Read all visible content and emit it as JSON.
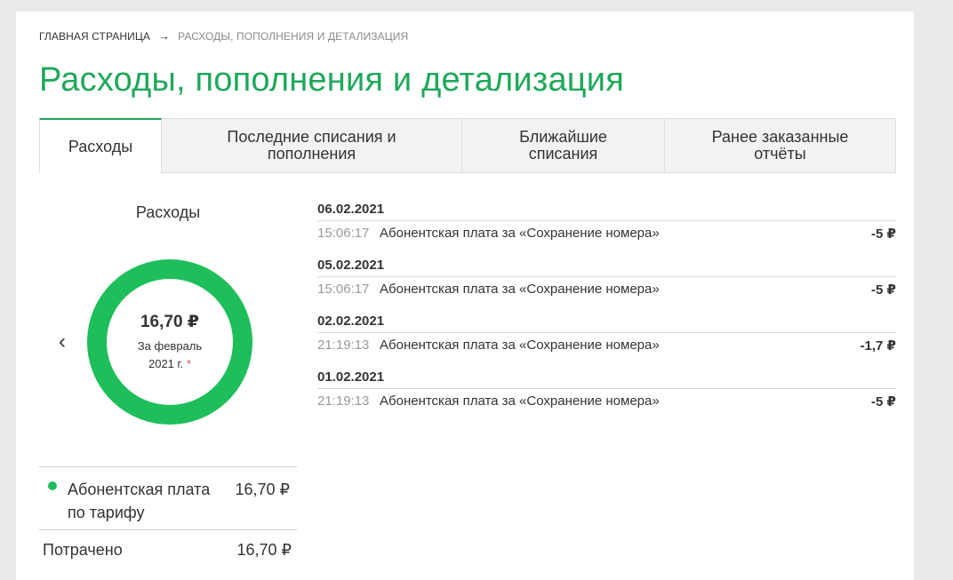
{
  "breadcrumb": {
    "home": "ГЛАВНАЯ СТРАНИЦА",
    "arrow": "→",
    "current": "РАСХОДЫ, ПОПОЛНЕНИЯ И ДЕТАЛИЗАЦИЯ"
  },
  "page_title": "Расходы, пополнения и детализация",
  "tabs": [
    {
      "line1": "Расходы",
      "line2": "",
      "active": true
    },
    {
      "line1": "Последние списания и",
      "line2": "пополнения",
      "active": false
    },
    {
      "line1": "Ближайшие",
      "line2": "списания",
      "active": false
    },
    {
      "line1": "Ранее заказанные",
      "line2": "отчёты",
      "active": false
    }
  ],
  "expenses": {
    "title": "Расходы",
    "prev_icon": "chevron-left-icon",
    "prev_glyph": "‹",
    "amount": "16,70 ₽",
    "period_line1": "За февраль",
    "period_line2": "2021 г.",
    "asterisk": "*",
    "donut_color": "#1ebe5a",
    "legend": [
      {
        "label": "Абонентская плата по тарифу",
        "value": "16,70 ₽",
        "color": "#1ebe5a"
      }
    ],
    "total_label": "Потрачено",
    "total_value": "16,70 ₽"
  },
  "history": [
    {
      "date": "06.02.2021",
      "time": "15:06:17",
      "description": "Абонентская плата за «Сохранение номера»",
      "amount": "-5 ₽"
    },
    {
      "date": "05.02.2021",
      "time": "15:06:17",
      "description": "Абонентская плата за «Сохранение номера»",
      "amount": "-5 ₽"
    },
    {
      "date": "02.02.2021",
      "time": "21:19:13",
      "description": "Абонентская плата за «Сохранение номера»",
      "amount": "-1,7 ₽"
    },
    {
      "date": "01.02.2021",
      "time": "21:19:13",
      "description": "Абонентская плата за «Сохранение номера»",
      "amount": "-5 ₽"
    }
  ],
  "colors": {
    "accent": "#1ea85a",
    "donut": "#1ebe5a",
    "asterisk": "#e05050"
  }
}
